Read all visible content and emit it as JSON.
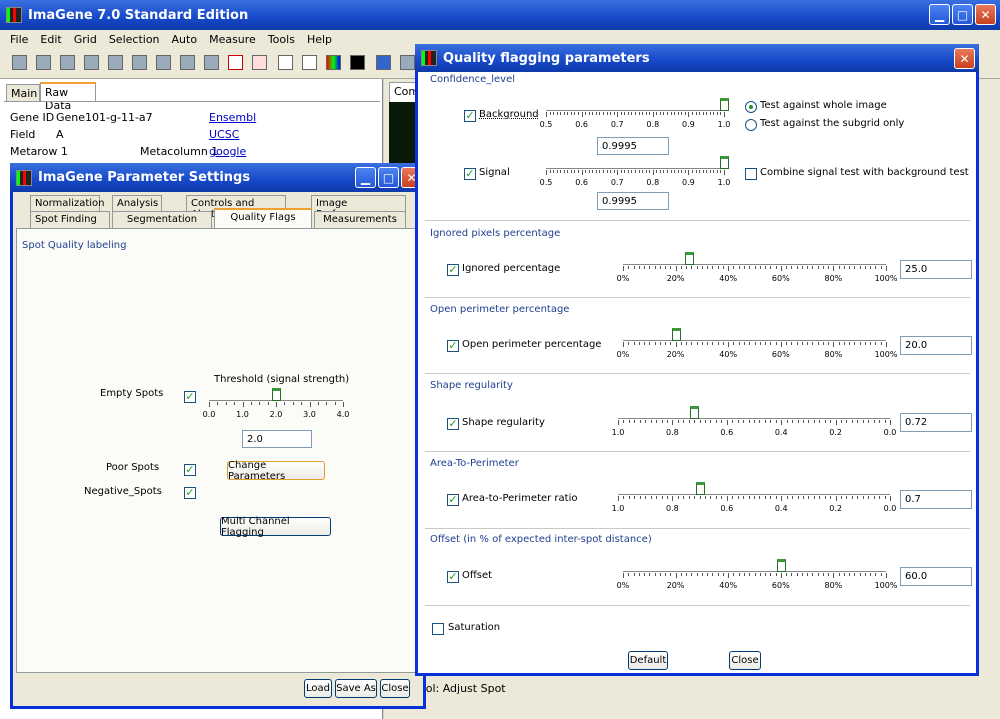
{
  "main_window": {
    "title": "ImaGene 7.0 Standard Edition",
    "menu": [
      "File",
      "Edit",
      "Grid",
      "Selection",
      "Auto",
      "Measure",
      "Tools",
      "Help"
    ],
    "tabs": [
      "Main",
      "Raw Data"
    ],
    "right_tab": "Comp",
    "gene_id_label": "Gene ID",
    "gene_id_value": "Gene101-g-11-a7",
    "field_label": "Field",
    "field_value": "A",
    "metarow_label": "Metarow 1",
    "metacolumn_label": "Metacolumn 1",
    "links": [
      "Ensembl",
      "UCSC",
      "google"
    ],
    "status_text": "ool: Adjust Spot"
  },
  "param_dialog": {
    "title": "ImaGene Parameter Settings",
    "tabs_row1": [
      "Normalization",
      "Analysis",
      "Controls and Alerts",
      "Image Preferences"
    ],
    "tabs_row2": [
      "Spot Finding",
      "Segmentation",
      "Quality Flags",
      "Measurements"
    ],
    "active_tab": "Quality Flags",
    "section_label": "Spot Quality labeling",
    "threshold_label": "Threshold (signal strength)",
    "threshold_ticks": [
      "0.0",
      "1.0",
      "2.0",
      "3.0",
      "4.0"
    ],
    "threshold_value": "2.0",
    "threshold_level": 2.0,
    "empty_spots_label": "Empty Spots",
    "poor_spots_label": "Poor Spots",
    "negative_spots_label": "Negative_Spots",
    "change_params_button": "Change Parameters",
    "multi_channel_button": "Multi Channel Flagging",
    "load_button": "Load",
    "save_as_button": "Save As",
    "close_button": "Close"
  },
  "quality_dialog": {
    "title": "Quality flagging parameters",
    "confidence": {
      "section": "Confidence_level",
      "ticks": [
        "0.5",
        "0.6",
        "0.7",
        "0.8",
        "0.9",
        "1.0"
      ],
      "background_label": "Background",
      "background_value": "0.9995",
      "background_level": 0.9995,
      "signal_label": "Signal",
      "signal_value": "0.9995",
      "signal_level": 0.9995,
      "radio_whole": "Test against whole image",
      "radio_subgrid": "Test against the subgrid only",
      "combine_label": "Combine signal test with background test"
    },
    "ignored": {
      "section": "Ignored pixels percentage",
      "label": "Ignored percentage",
      "value": "25.0",
      "level": 25,
      "ticks": [
        "0%",
        "20%",
        "40%",
        "60%",
        "80%",
        "100%"
      ]
    },
    "open_perimeter": {
      "section": "Open perimeter percentage",
      "label": "Open perimeter percentage",
      "value": "20.0",
      "level": 20,
      "ticks": [
        "0%",
        "20%",
        "40%",
        "60%",
        "80%",
        "100%"
      ]
    },
    "shape": {
      "section": "Shape regularity",
      "label": "Shape regularity",
      "value": "0.72",
      "level": 0.72,
      "ticks": [
        "1.0",
        "0.8",
        "0.6",
        "0.4",
        "0.2",
        "0.0"
      ]
    },
    "area": {
      "section": "Area-To-Perimeter",
      "label": "Area-to-Perimeter ratio",
      "value": "0.7",
      "level": 0.7,
      "ticks": [
        "1.0",
        "0.8",
        "0.6",
        "0.4",
        "0.2",
        "0.0"
      ]
    },
    "offset": {
      "section": "Offset (in % of expected inter-spot distance)",
      "label": "Offset",
      "value": "60.0",
      "level": 60,
      "ticks": [
        "0%",
        "20%",
        "40%",
        "60%",
        "80%",
        "100%"
      ]
    },
    "saturation_label": "Saturation",
    "default_button": "Default",
    "close_button": "Close"
  }
}
